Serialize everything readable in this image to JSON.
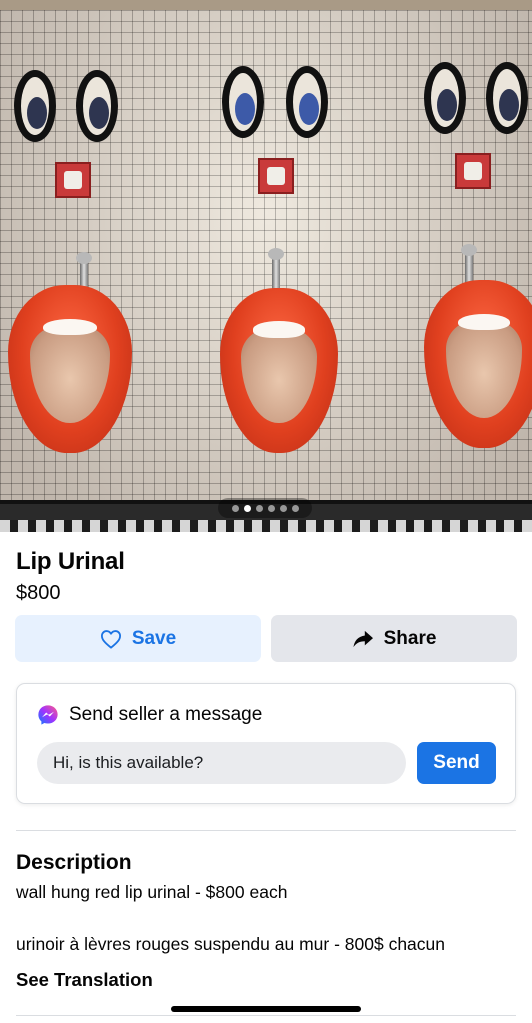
{
  "listing": {
    "title": "Lip Urinal",
    "price": "$800",
    "photo_pager": {
      "count": 6,
      "active_index": 1
    }
  },
  "actions": {
    "save_label": "Save",
    "share_label": "Share",
    "save_icon": "heart-outline-icon",
    "share_icon": "share-arrow-icon"
  },
  "message": {
    "header": "Send seller a message",
    "icon": "messenger-icon",
    "input_value": "Hi, is this available?",
    "send_label": "Send"
  },
  "description": {
    "heading": "Description",
    "line1": "wall hung red lip urinal - $800 each",
    "line2": "urinoir à lèvres rouges suspendu au mur - 800$ chacun",
    "translate_link": "See Translation"
  },
  "colors": {
    "accent": "#1b74e4",
    "save_bg": "#e7f1fe",
    "share_bg": "#e4e6eb"
  }
}
